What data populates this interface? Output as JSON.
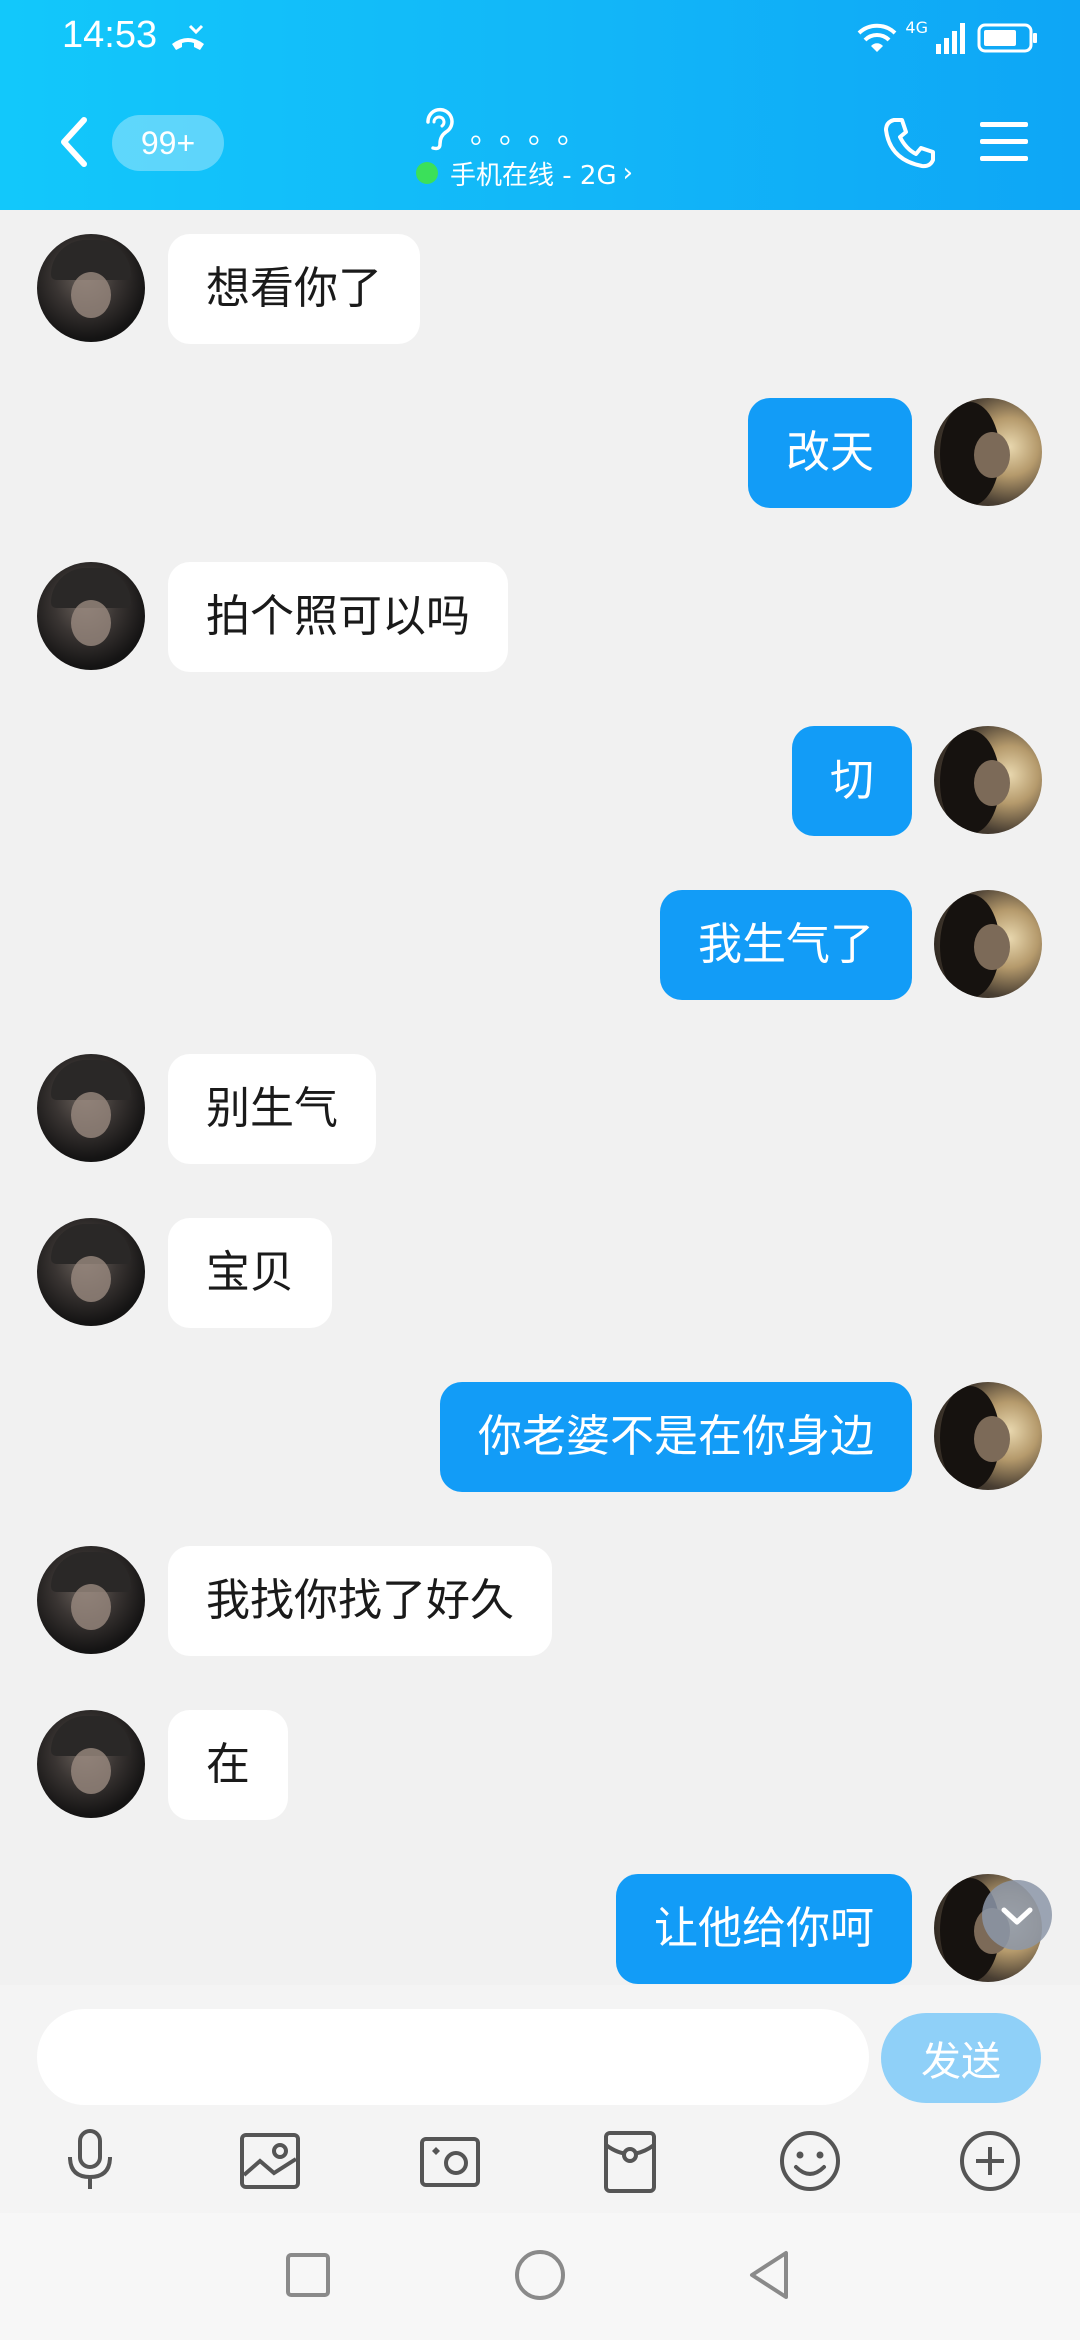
{
  "status_bar": {
    "time": "14:53",
    "network": "4G",
    "icons": [
      "missed-call-icon",
      "wifi-icon",
      "signal-icon",
      "battery-icon"
    ]
  },
  "header": {
    "unread_count": "99+",
    "contact_name": "。。。。",
    "online_status": "手机在线 - 2G",
    "online_chevron": "›",
    "icons": [
      "back-icon",
      "ear-icon",
      "phone-icon",
      "menu-icon"
    ]
  },
  "colors": {
    "header_bg": "#12b6f8",
    "my_bubble": "#129cf7",
    "other_bubble": "#ffffff",
    "chat_bg": "#f1f1f1",
    "send_button": "#8fd0f8",
    "online_dot": "#3be05a"
  },
  "messages": [
    {
      "from": "other",
      "text": "想看你了"
    },
    {
      "from": "me",
      "text": "改天"
    },
    {
      "from": "other",
      "text": "拍个照可以吗"
    },
    {
      "from": "me",
      "text": "切"
    },
    {
      "from": "me",
      "text": "我生气了"
    },
    {
      "from": "other",
      "text": "别生气"
    },
    {
      "from": "other",
      "text": "宝贝"
    },
    {
      "from": "me",
      "text": "你老婆不是在你身边"
    },
    {
      "from": "other",
      "text": "我找你找了好久"
    },
    {
      "from": "other",
      "text": "在"
    },
    {
      "from": "me",
      "text": "让他给你呵"
    }
  ],
  "input": {
    "placeholder": "",
    "value": "",
    "send_label": "发送"
  },
  "toolbar": [
    "microphone-icon",
    "image-icon",
    "camera-icon",
    "red-packet-icon",
    "emoji-icon",
    "plus-icon"
  ],
  "navbar": [
    "recent-apps-icon",
    "home-icon",
    "back-triangle-icon"
  ]
}
